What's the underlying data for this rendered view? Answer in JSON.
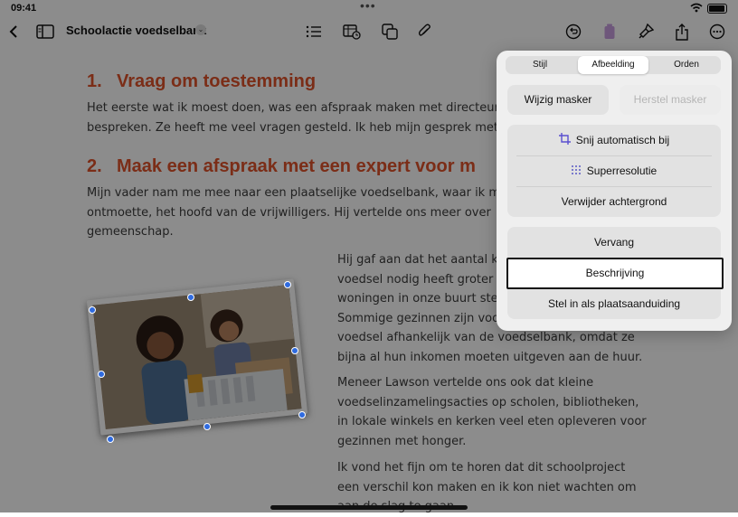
{
  "status": {
    "time": "09:41"
  },
  "toolbar": {
    "doc_title": "Schoolactie voedselbank",
    "icons": [
      "back-icon",
      "sidebar-icon",
      "list-icon",
      "table-icon",
      "shapes-icon",
      "attachment-icon",
      "undo-icon",
      "delete-icon",
      "format-brush-icon",
      "share-icon",
      "more-icon"
    ]
  },
  "document": {
    "h1_num": "1.",
    "h1_text": "Vraag om toestemming",
    "p1_line1": "Het eerste wat ik moest doen, was een afspraak maken met directeur",
    "p1_line2": "bespreken. Ze heeft me veel vragen gesteld. Ik heb mijn gesprek met",
    "h2_num": "2.",
    "h2_text": "Maak een afspraak met een expert voor m",
    "p2_line1": "Mijn vader nam me mee naar een plaatselijke voedselbank, waar ik m",
    "p2_line2": "ontmoette, het hoofd van de vrijwilligers. Hij vertelde ons meer over",
    "p2_line3": "gemeenschap.",
    "p3_line1": "Hij gaf aan dat het aantal k",
    "p3_line2": "voedsel nodig heeft groter",
    "p3_line3": "woningen in onze buurt ste",
    "p3_line4": "Sommige gezinnen zijn voo",
    "p3_line5": "voedsel afhankelijk van de voedselbank, omdat ze",
    "p3_line6": "bijna al hun inkomen moeten uitgeven aan de huur.",
    "p4_line1": "Meneer Lawson vertelde ons ook dat kleine",
    "p4_line2": "voedselinzamelingsacties op scholen, bibliotheken,",
    "p4_line3": "in lokale winkels en kerken veel eten opleveren voor",
    "p4_line4": "gezinnen met honger.",
    "p5_line1": "Ik vond het fijn om te horen dat dit schoolproject",
    "p5_line2": "een verschil kon maken en ik kon niet wachten om",
    "p5_line3": "aan de slag te gaan."
  },
  "popover": {
    "tabs": [
      "Stijl",
      "Afbeelding",
      "Orden"
    ],
    "selected_tab": "Afbeelding",
    "edit_mask": "Wijzig masker",
    "reset_mask": "Herstel masker",
    "auto_crop": "Snij automatisch bij",
    "super_resolution": "Superresolutie",
    "remove_background": "Verwijder achtergrond",
    "replace": "Vervang",
    "description": "Beschrijving",
    "set_placeholder": "Stel in als plaatsaanduiding"
  },
  "colors": {
    "heading": "#e0522a",
    "selection": "#2f6be0",
    "popover_bg": "#efefef"
  }
}
